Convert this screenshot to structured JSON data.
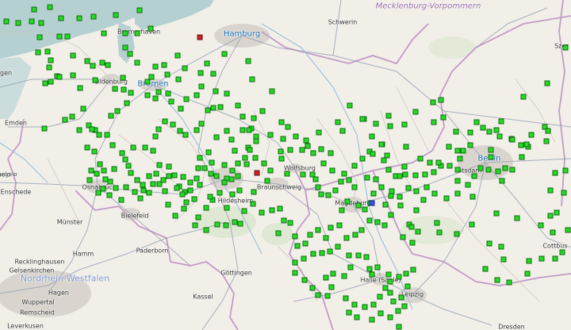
{
  "map": {
    "colors": {
      "background": "#f2efe9",
      "water": "#b5d0d0",
      "urban": "#d9d5ce",
      "forest": "#d5e6c8",
      "road": "#8d99ae",
      "state_border": "#c29bc6",
      "marker_active": "#22dd22",
      "marker_alert": "#cc2222",
      "marker_other": "#3355ff"
    },
    "labels": [
      {
        "id": "mecklenburg",
        "text": "Mecklenburg-Vorpommern",
        "cls": "region"
      },
      {
        "id": "hamburg",
        "text": "Hamburg",
        "cls": "big"
      },
      {
        "id": "schwerin",
        "text": "Schwerin",
        "cls": ""
      },
      {
        "id": "bremerhaven",
        "text": "Bremerhaven",
        "cls": ""
      },
      {
        "id": "oldenburg",
        "text": "Oldenburg",
        "cls": ""
      },
      {
        "id": "bremen",
        "text": "Bremen",
        "cls": "big"
      },
      {
        "id": "emden",
        "text": "Emden",
        "cls": ""
      },
      {
        "id": "hengelo",
        "text": "Hengelo",
        "cls": "small"
      },
      {
        "id": "enschede",
        "text": "Enschede",
        "cls": ""
      },
      {
        "id": "osnabrueck",
        "text": "Osnabrück",
        "cls": ""
      },
      {
        "id": "bielefeld",
        "text": "Bielefeld",
        "cls": ""
      },
      {
        "id": "muenster",
        "text": "Münster",
        "cls": ""
      },
      {
        "id": "hamm",
        "text": "Hamm",
        "cls": ""
      },
      {
        "id": "paderborn",
        "text": "Paderborn",
        "cls": ""
      },
      {
        "id": "recklinghausen",
        "text": "Recklinghausen",
        "cls": ""
      },
      {
        "id": "gelsenkirchen",
        "text": "Gelsenkirchen",
        "cls": ""
      },
      {
        "id": "nrw",
        "text": "Nordrhein-Westfalen",
        "cls": "regionblue"
      },
      {
        "id": "hagen",
        "text": "Hagen",
        "cls": ""
      },
      {
        "id": "wuppertal",
        "text": "Wuppertal",
        "cls": ""
      },
      {
        "id": "remscheid",
        "text": "Remscheid",
        "cls": ""
      },
      {
        "id": "leverkusen",
        "text": "Leverkusen",
        "cls": ""
      },
      {
        "id": "hildesheim",
        "text": "Hildesheim",
        "cls": ""
      },
      {
        "id": "braunschweig",
        "text": "Braunschweig",
        "cls": ""
      },
      {
        "id": "wolfsburg",
        "text": "Wolfsburg",
        "cls": ""
      },
      {
        "id": "magdeburg",
        "text": "Magdeburg",
        "cls": ""
      },
      {
        "id": "berlin",
        "text": "Berlin",
        "cls": "big"
      },
      {
        "id": "potsdam",
        "text": "Potsdam",
        "cls": ""
      },
      {
        "id": "goettingen",
        "text": "Göttingen",
        "cls": ""
      },
      {
        "id": "kassel",
        "text": "Kassel",
        "cls": ""
      },
      {
        "id": "halle",
        "text": "Halle (Saale)",
        "cls": ""
      },
      {
        "id": "leipzig",
        "text": "Leipzig",
        "cls": ""
      },
      {
        "id": "cottbus",
        "text": "Cottbus",
        "cls": ""
      },
      {
        "id": "dresden",
        "text": "Dresden",
        "cls": ""
      },
      {
        "id": "szcz",
        "text": "Szcz",
        "cls": ""
      },
      {
        "id": "ngen",
        "text": "ngen",
        "cls": ""
      },
      {
        "id": "helo",
        "text": "helo",
        "cls": ""
      }
    ]
  }
}
